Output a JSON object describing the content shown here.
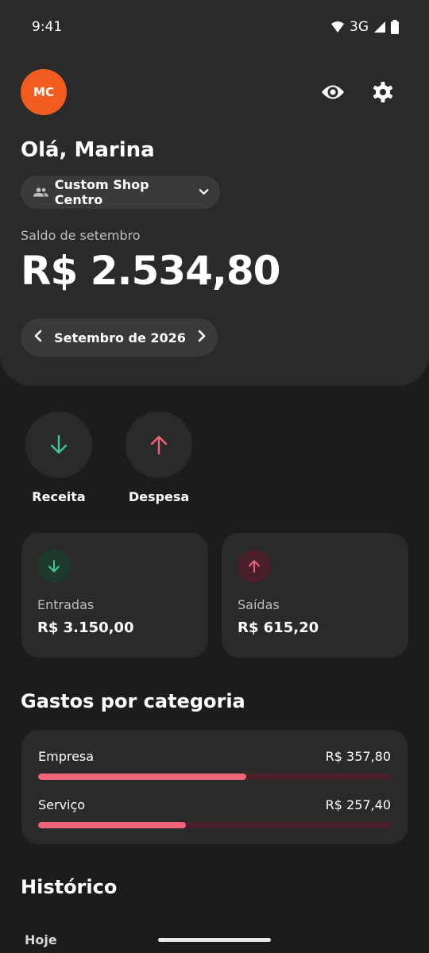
{
  "status": {
    "time": "9:41",
    "network": "3G"
  },
  "header": {
    "avatar_initials": "MC",
    "greeting": "Olá, Marina",
    "shop_name": "Custom Shop Centro",
    "balance_label": "Saldo de setembro",
    "balance_value": "R$ 2.534,80",
    "month_label": "Setembro de 2026"
  },
  "actions": {
    "income_label": "Receita",
    "expense_label": "Despesa"
  },
  "summary": {
    "income_label": "Entradas",
    "income_value": "R$ 3.150,00",
    "expense_label": "Saídas",
    "expense_value": "R$ 615,20"
  },
  "categories": {
    "title": "Gastos por categoria",
    "items": [
      {
        "name": "Empresa",
        "amount": "R$ 357,80",
        "share": 0.59
      },
      {
        "name": "Serviço",
        "amount": "R$ 257,40",
        "share": 0.42
      }
    ]
  },
  "history": {
    "title": "Histórico",
    "group_today": "Hoje"
  },
  "colors": {
    "accent_orange": "#f25c1f",
    "income_green": "#3ec88c",
    "expense_pink": "#f0647a"
  },
  "icons": {
    "visibility": "eye-icon",
    "settings": "gear-icon",
    "income": "arrow-down-icon",
    "expense": "arrow-up-icon"
  }
}
